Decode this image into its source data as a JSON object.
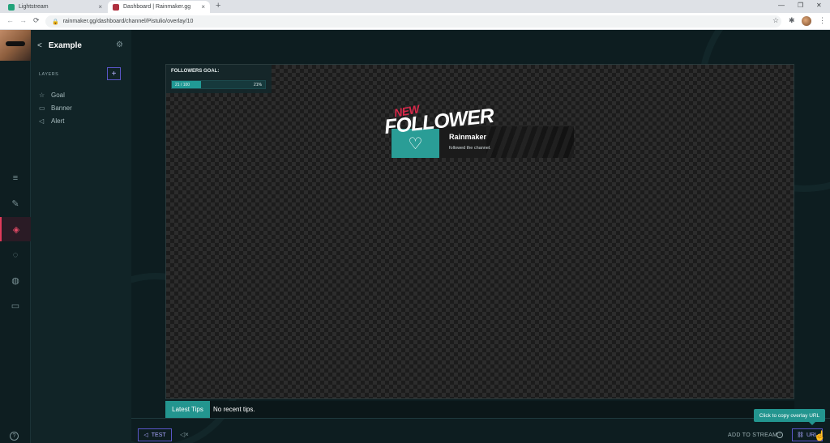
{
  "browser": {
    "tabs": [
      {
        "label": "Lightstream",
        "favicon_color": "#22a37a"
      },
      {
        "label": "Dashboard | Rainmaker.gg",
        "favicon_color": "#b0303f"
      }
    ],
    "tab_close": "×",
    "new_tab": "+",
    "url": "rainmaker.gg/dashboard/channel/Pistulio/overlay/10",
    "nav": {
      "back": "←",
      "forward": "→",
      "reload": "⟳"
    },
    "win": {
      "minimize": "—",
      "maximize": "❐",
      "close": "✕"
    },
    "toolbar_icons": {
      "star": "☆",
      "extensions": "✱",
      "menu": "⋮"
    }
  },
  "sidebar": {
    "back_glyph": "<",
    "overlay_name": "Example",
    "gear_glyph": "⚙",
    "layers_label": "LAYERS",
    "add_glyph": "+",
    "layers": [
      {
        "label": "Goal",
        "icon": "☆"
      },
      {
        "label": "Banner",
        "icon": "▭"
      },
      {
        "label": "Alert",
        "icon": "◁"
      }
    ],
    "rail_icons": [
      "≡",
      "✎",
      "◈",
      "◌",
      "◍",
      "▭"
    ],
    "help_glyph": "?"
  },
  "goal_widget": {
    "title": "FOLLOWERS GOAL:",
    "count": "21 / 100",
    "percent": "21%",
    "progress": 0.21
  },
  "alert": {
    "new_label": "NEW",
    "follower_label": "FOLLOWER",
    "name": "Rainmaker",
    "message": "followed the channel.",
    "heart": "♡"
  },
  "tips": {
    "label": "Latest Tips",
    "text": "No recent tips."
  },
  "bottombar": {
    "test_label": "TEST",
    "test_icon": "◁",
    "mute_icon": "◁×",
    "add_to_stream": "ADD TO STREAM",
    "info_glyph": "i",
    "url_label": "URL",
    "url_icon": "⛓",
    "tooltip": "Click to copy overlay URL",
    "cursor": "☝"
  },
  "colors": {
    "accent_teal": "#23958f",
    "accent_purple": "#5a56c8",
    "active_red": "#e03a5a",
    "background": "#0f2124"
  }
}
